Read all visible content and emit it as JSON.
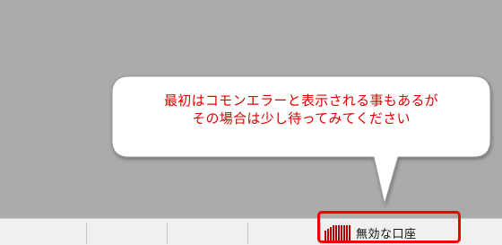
{
  "callout": {
    "line1": "最初はコモンエラーと表示される事もあるが",
    "line2": "その場合は少し待ってみてください",
    "text_color": "#e00000"
  },
  "statusbar": {
    "account_status": "無効な口座",
    "account_icon": "signal-bars-icon",
    "highlight_color": "#ee0000"
  }
}
